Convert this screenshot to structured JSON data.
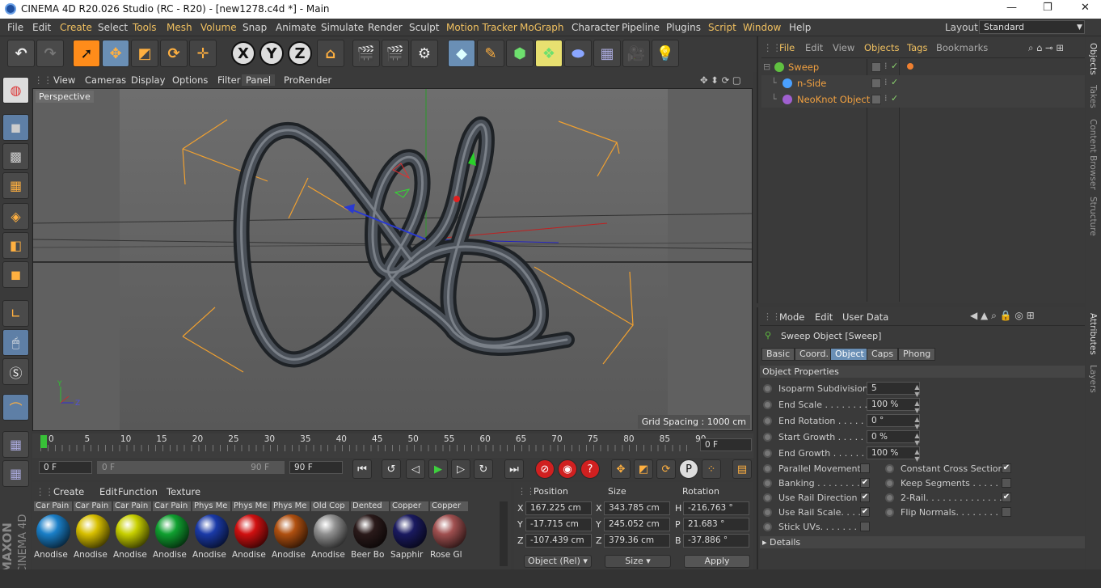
{
  "window": {
    "title": "CINEMA 4D R20.026 Studio (RC - R20) - [new1278.c4d *] - Main",
    "minimize": "—",
    "restore": "❐",
    "close": "✕"
  },
  "menubar": {
    "items": [
      "File",
      "Edit",
      "Create",
      "Select",
      "Tools",
      "Mesh",
      "Volume",
      "Snap",
      "Animate",
      "Simulate",
      "Render",
      "Sculpt",
      "Motion Tracker",
      "MoGraph",
      "Character",
      "Pipeline",
      "Plugins",
      "Script",
      "Window",
      "Help"
    ],
    "layout_label": "Layout:",
    "layout_value": "Standard"
  },
  "toolbar": {
    "x": "X",
    "y": "Y",
    "z": "Z"
  },
  "viewport_menu": {
    "items": [
      "View",
      "Cameras",
      "Display",
      "Options",
      "Filter",
      "Panel",
      "ProRender"
    ],
    "camera_label": "Perspective",
    "grid_spacing": "Grid Spacing : 1000 cm"
  },
  "timeline": {
    "ticks": [
      "0",
      "5",
      "10",
      "15",
      "20",
      "25",
      "30",
      "35",
      "40",
      "45",
      "50",
      "55",
      "60",
      "65",
      "70",
      "75",
      "80",
      "85",
      "90"
    ],
    "current_frame": "0 F",
    "start_frame": "0 F",
    "range_start": "0 F",
    "range_end": "90 F",
    "end_frame": "90 F"
  },
  "materials": {
    "menu": [
      "Create",
      "Edit",
      "Function",
      "Texture"
    ],
    "items": [
      {
        "label": "Car Pain",
        "name": "Anodise",
        "color": "#1a7fc8"
      },
      {
        "label": "Car Pain",
        "name": "Anodise",
        "color": "#d8c000"
      },
      {
        "label": "Car Pain",
        "name": "Anodise",
        "color": "#c8d000"
      },
      {
        "label": "Car Pain",
        "name": "Anodise",
        "color": "#10a030"
      },
      {
        "label": "Phys Me",
        "name": "Anodise",
        "color": "#1a3aa8"
      },
      {
        "label": "Phys Me",
        "name": "Anodise",
        "color": "#d01010"
      },
      {
        "label": "Phys Me",
        "name": "Anodise",
        "color": "#b05010"
      },
      {
        "label": "Old Cop",
        "name": "Anodise",
        "color": "#909090"
      },
      {
        "label": "Dented",
        "name": "Beer Bo",
        "color": "#2a1a1a"
      },
      {
        "label": "Copper",
        "name": "Sapphir",
        "color": "#1a1a60"
      },
      {
        "label": "Copper",
        "name": "Rose Gl",
        "color": "#a05050"
      }
    ]
  },
  "coordinates": {
    "headers": [
      "Position",
      "Size",
      "Rotation"
    ],
    "rows": [
      {
        "pa": "X",
        "pv": "167.225 cm",
        "sa": "X",
        "sv": "343.785 cm",
        "ra": "H",
        "rv": "-216.763 °"
      },
      {
        "pa": "Y",
        "pv": "-17.715 cm",
        "sa": "Y",
        "sv": "245.052 cm",
        "ra": "P",
        "rv": "21.683 °"
      },
      {
        "pa": "Z",
        "pv": "-107.439 cm",
        "sa": "Z",
        "sv": "379.36 cm",
        "ra": "B",
        "rv": "-37.886 °"
      }
    ],
    "mode": "Object (Rel)",
    "size_mode": "Size",
    "apply": "Apply"
  },
  "objects": {
    "menu": [
      "File",
      "Edit",
      "View",
      "Objects",
      "Tags",
      "Bookmarks"
    ],
    "items": [
      {
        "name": "Sweep",
        "icon_color": "#60c040"
      },
      {
        "name": "n-Side",
        "icon_color": "#4aa0ff"
      },
      {
        "name": "NeoKnot Object",
        "icon_color": "#a060d0"
      }
    ]
  },
  "side_tabs": {
    "top": [
      "Objects",
      "Takes",
      "Content Browser",
      "Structure"
    ],
    "bottom": [
      "Attributes",
      "Layers"
    ]
  },
  "attributes": {
    "menu": [
      "Mode",
      "Edit",
      "User Data"
    ],
    "object_title": "Sweep Object [Sweep]",
    "tabs": [
      "Basic",
      "Coord.",
      "Object",
      "Caps",
      "Phong"
    ],
    "section": "Object Properties",
    "fields": [
      {
        "label": "Isoparm Subdivision",
        "value": "5"
      },
      {
        "label": "End Scale . . . . . . . . . .",
        "value": "100 %"
      },
      {
        "label": "End Rotation . . . . . . .",
        "value": "0 °"
      },
      {
        "label": "Start Growth . . . . . . .",
        "value": "0 %"
      },
      {
        "label": "End Growth . . . . . . . .",
        "value": "100 %"
      }
    ],
    "checks_left": [
      {
        "label": "Parallel Movement",
        "checked": ""
      },
      {
        "label": "Banking . . . . . . . . .",
        "checked": "✔"
      },
      {
        "label": "Use Rail Direction",
        "checked": "✔"
      },
      {
        "label": "Use Rail Scale. . . .",
        "checked": "✔"
      },
      {
        "label": "Stick UVs. . . . . . . .",
        "checked": ""
      }
    ],
    "checks_right": [
      {
        "label": "Constant Cross Section",
        "checked": "✔"
      },
      {
        "label": "Keep Segments . . . . . . .",
        "checked": ""
      },
      {
        "label": "2-Rail. . . . . . . . . . . . . . .",
        "checked": "✔"
      },
      {
        "label": "Flip Normals. . . . . . . . .",
        "checked": ""
      }
    ],
    "details": "Details"
  },
  "branding": {
    "maxon": "MAXON",
    "c4d": "CINEMA 4D"
  }
}
